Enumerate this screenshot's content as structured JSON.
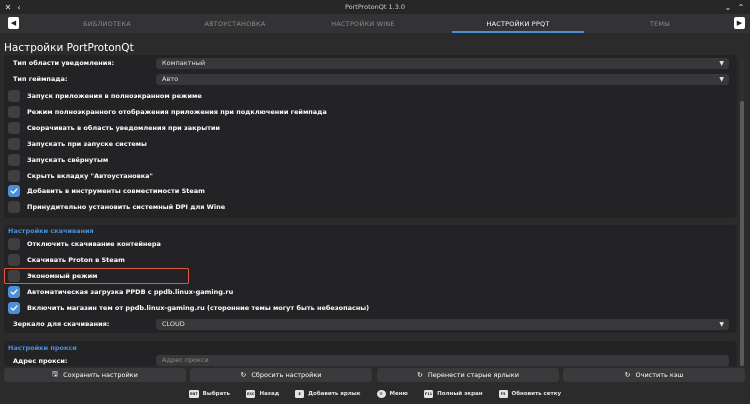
{
  "window": {
    "title": "PortProtonQt 1.3.0"
  },
  "tabs": [
    {
      "label": "БИБЛИОТЕКА",
      "active": false
    },
    {
      "label": "АВТОУСТАНОВКА",
      "active": false
    },
    {
      "label": "НАСТРОЙКИ WINE",
      "active": false
    },
    {
      "label": "НАСТРОЙКИ PPQT",
      "active": true
    },
    {
      "label": "ТЕМЫ",
      "active": false
    }
  ],
  "page": {
    "title": "Настройки PortProtonQt"
  },
  "general": {
    "tray_label": "Тип области уведомления:",
    "tray_value": "Компактный",
    "gamepad_label": "Тип геймпада:",
    "gamepad_value": "Авто",
    "checkboxes": [
      {
        "label": "Запуск приложения в полноэкранном режиме",
        "checked": false
      },
      {
        "label": "Режим полноэкранного отображения приложения при подключении геймпада",
        "checked": false
      },
      {
        "label": "Сворачивать в область уведомления при закрытии",
        "checked": false
      },
      {
        "label": "Запускать при запуске системы",
        "checked": false
      },
      {
        "label": "Запускать свёрнутым",
        "checked": false
      },
      {
        "label": "Скрыть вкладку \"Автоустановка\"",
        "checked": false
      },
      {
        "label": "Добавить в инструменты совместимости Steam",
        "checked": true
      },
      {
        "label": "Принудительно установить системный DPI для Wine",
        "checked": false
      }
    ]
  },
  "downloads": {
    "title": "Настройки скачивания",
    "checkboxes": [
      {
        "label": "Отключить скачивание контейнера",
        "checked": false
      },
      {
        "label": "Скачивать Proton в Steam",
        "checked": false
      },
      {
        "label": "Экономный режим",
        "checked": false
      },
      {
        "label": "Автоматическая загрузка PPDB с ppdb.linux-gaming.ru",
        "checked": true
      },
      {
        "label": "Включить магазин тем от ppdb.linux-gaming.ru (сторонние темы могут быть небезопасны)",
        "checked": true
      }
    ],
    "mirror_label": "Зеркало для скачивания:",
    "mirror_value": "CLOUD"
  },
  "proxy": {
    "title": "Настройки прокси",
    "address_label": "Адрес прокси:",
    "address_placeholder": "Адрес прокси"
  },
  "actions": {
    "save": "Сохранить настройки",
    "reset": "Сбросить настройки",
    "migrate": "Перенести старые ярлыки",
    "clear_cache": "Очистить кэш"
  },
  "hints": [
    {
      "key": "ENT",
      "label": "Выбрать"
    },
    {
      "key": "ESC",
      "label": "Назад"
    },
    {
      "key": "E",
      "label": "Добавить ярлык"
    },
    {
      "key": "☰",
      "label": "Меню"
    },
    {
      "key": "F11",
      "label": "Полный экран"
    },
    {
      "key": "F5",
      "label": "Обновить сетку"
    }
  ],
  "colors": {
    "accent": "#4a90d9",
    "highlight": "#e05a3b"
  }
}
